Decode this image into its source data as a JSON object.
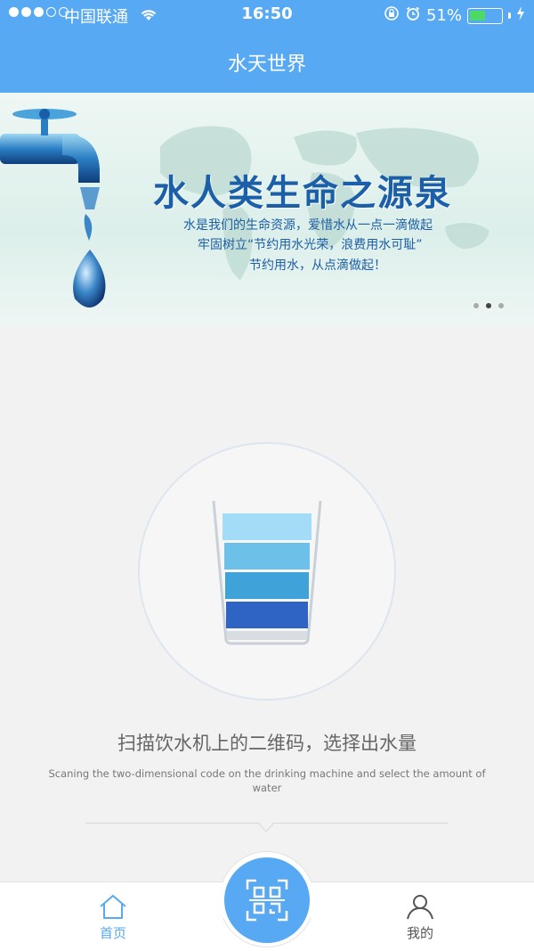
{
  "status": {
    "carrier": "中国联通",
    "time": "16:50",
    "battery_percent": "51%",
    "battery_level": 0.51,
    "battery_fill_color": "#4cd964"
  },
  "nav": {
    "title": "水天世界"
  },
  "banner": {
    "headline": "水人类生命之源泉",
    "lines": [
      "水是我们的生命资源，爱惜水从一点一滴做起",
      "牢固树立“节约用水光荣，浪费用水可耻”",
      "节约用水，从点滴做起！"
    ],
    "page_index": 1,
    "page_count": 3
  },
  "main": {
    "instruction_cn": "扫描饮水机上的二维码，选择出水量",
    "instruction_en": "Scaning the two-dimensional code on the drinking machine and select the amount of water"
  },
  "tabs": [
    {
      "label": "首页",
      "icon": "home-icon",
      "active": true
    },
    {
      "label": "",
      "icon": "qr-scan-icon"
    },
    {
      "label": "我的",
      "icon": "person-icon"
    }
  ],
  "colors": {
    "accent": "#58a9f3",
    "glass_layers": [
      "#a3dcf6",
      "#6dc0e8",
      "#3fa3da",
      "#2f63c4"
    ]
  }
}
